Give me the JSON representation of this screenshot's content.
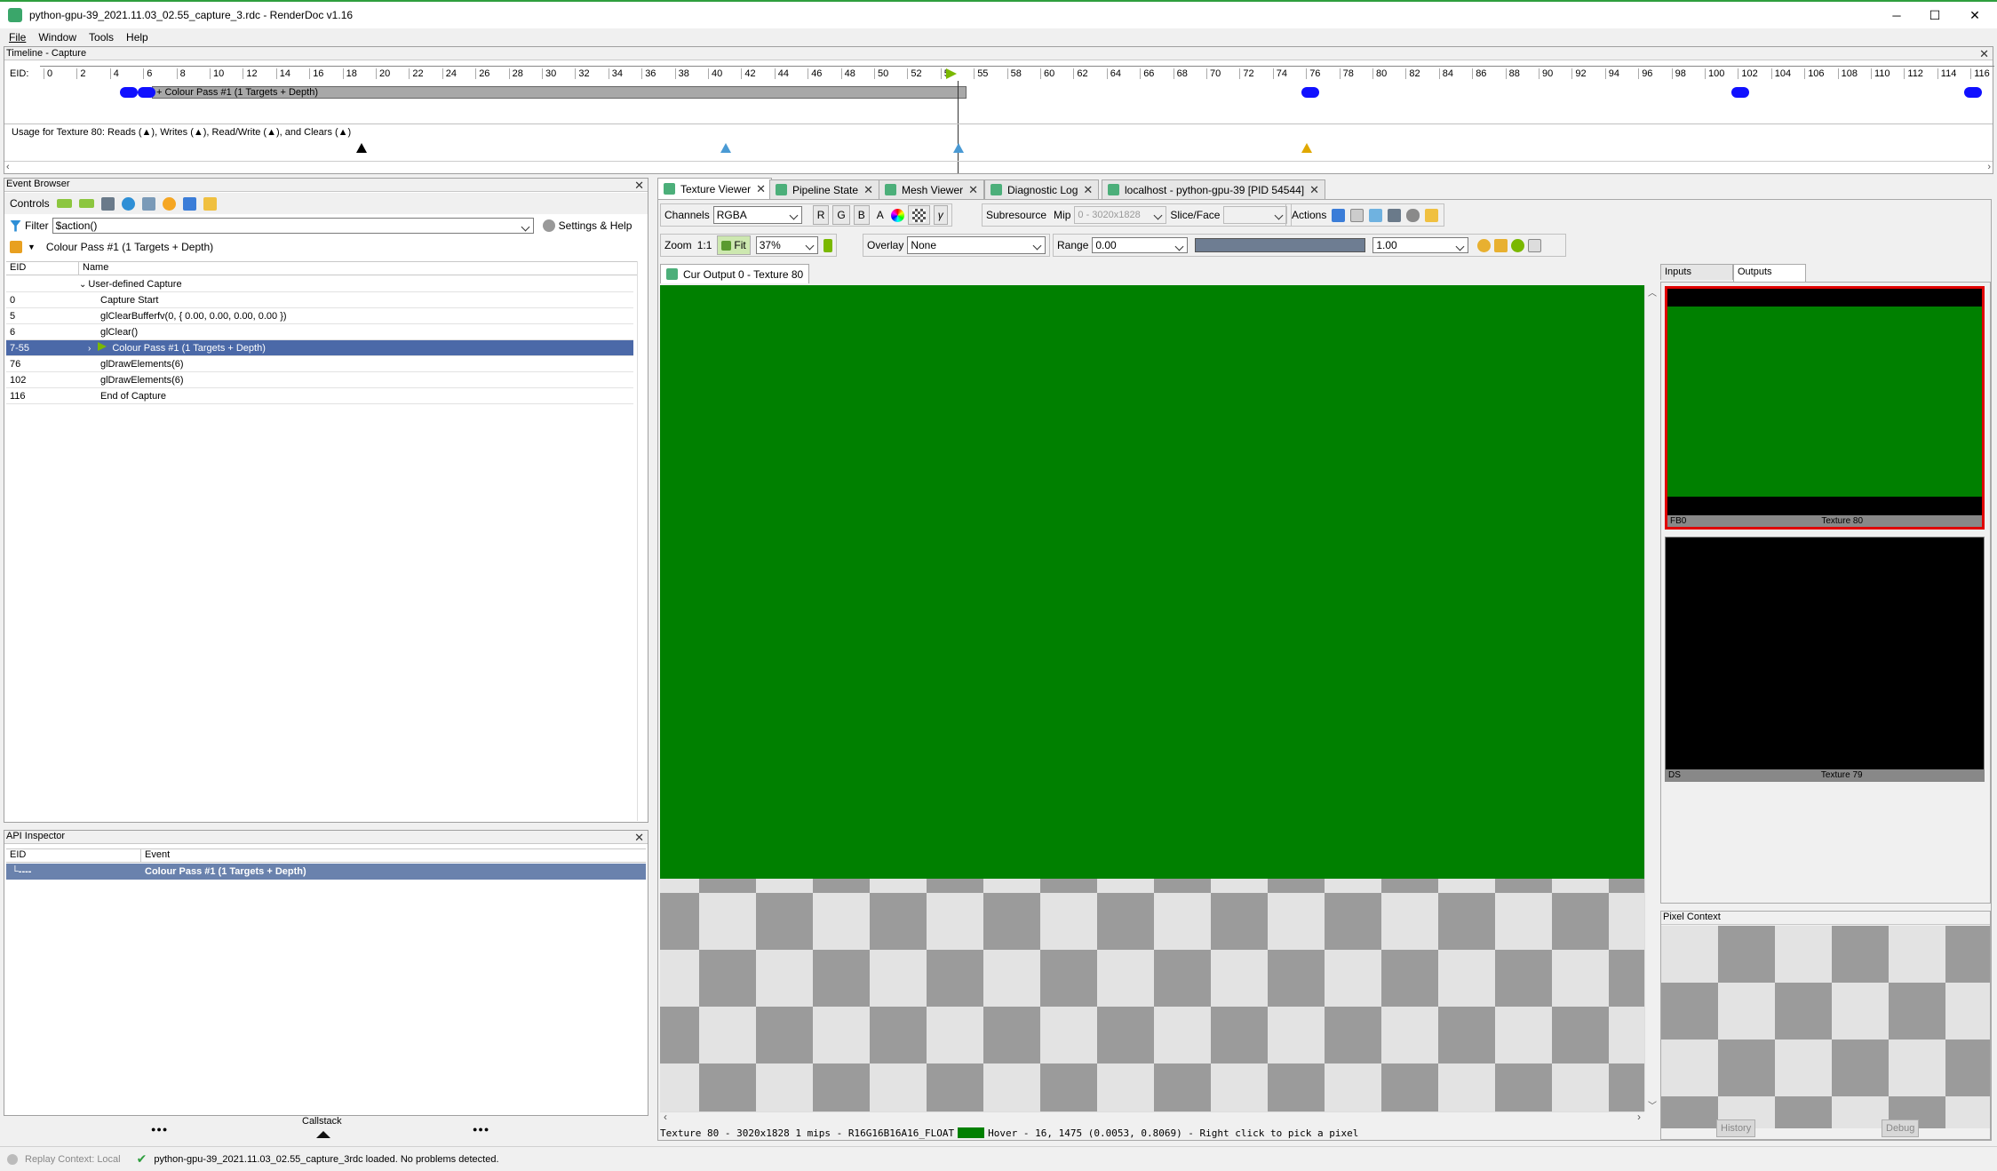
{
  "window": {
    "title": "python-gpu-39_2021.11.03_02.55_capture_3.rdc - RenderDoc v1.16",
    "minimize": "─",
    "maximize": "☐",
    "close": "✕"
  },
  "menu": [
    "File",
    "Window",
    "Tools",
    "Help"
  ],
  "timeline": {
    "title": "Timeline - Capture",
    "eid_label": "EID:",
    "ticks": [
      "0",
      "2",
      "4",
      "6",
      "8",
      "10",
      "12",
      "14",
      "16",
      "18",
      "20",
      "22",
      "24",
      "26",
      "28",
      "30",
      "32",
      "34",
      "36",
      "38",
      "40",
      "42",
      "44",
      "46",
      "48",
      "50",
      "52",
      "5",
      "55",
      "58",
      "60",
      "62",
      "64",
      "66",
      "68",
      "70",
      "72",
      "74",
      "76",
      "78",
      "80",
      "82",
      "84",
      "86",
      "88",
      "90",
      "92",
      "94",
      "96",
      "98",
      "100",
      "102",
      "104",
      "106",
      "108",
      "110",
      "112",
      "114",
      "116"
    ],
    "pass_label": "+ Colour Pass #1 (1 Targets + Depth)",
    "usage_text": "Usage for Texture 80: Reads (▲), Writes (▲), Read/Write (▲), and Clears (▲)"
  },
  "event_browser": {
    "title": "Event Browser",
    "controls_label": "Controls",
    "filter_label": "Filter",
    "filter_value": "$action()",
    "settings_label": "Settings & Help",
    "breadcrumb": "Colour Pass #1 (1 Targets + Depth)",
    "columns": {
      "eid": "EID",
      "name": "Name"
    },
    "rows": [
      {
        "eid": "",
        "name": "User-defined Capture"
      },
      {
        "eid": "0",
        "name": "Capture Start"
      },
      {
        "eid": "5",
        "name": "glClearBufferfv(0, { 0.00, 0.00, 0.00, 0.00 })"
      },
      {
        "eid": "6",
        "name": "glClear()"
      },
      {
        "eid": "7-55",
        "name": "Colour Pass #1 (1 Targets + Depth)"
      },
      {
        "eid": "76",
        "name": "glDrawElements(6)"
      },
      {
        "eid": "102",
        "name": "glDrawElements(6)"
      },
      {
        "eid": "116",
        "name": "End of Capture"
      }
    ]
  },
  "api_inspector": {
    "title": "API Inspector",
    "columns": {
      "eid": "EID",
      "event": "Event"
    },
    "row": {
      "eid": "└----",
      "event": "Colour Pass #1 (1 Targets + Depth)"
    },
    "callstack": "Callstack",
    "dots": "●●●"
  },
  "tabs": [
    {
      "label": "Texture Viewer"
    },
    {
      "label": "Pipeline State"
    },
    {
      "label": "Mesh Viewer"
    },
    {
      "label": "Diagnostic Log"
    },
    {
      "label": "localhost - python-gpu-39 [PID 54544]"
    }
  ],
  "toolbar": {
    "channels_label": "Channels",
    "channels_value": "RGBA",
    "r": "R",
    "g": "G",
    "b": "B",
    "a": "A",
    "subresource_label": "Subresource",
    "mip_label": "Mip",
    "mip_value": "0 - 3020x1828",
    "slice_label": "Slice/Face",
    "actions_label": "Actions",
    "zoom_label": "Zoom",
    "zoom_1to1": "1:1",
    "fit_label": "Fit",
    "zoom_value": "37%",
    "overlay_label": "Overlay",
    "overlay_value": "None",
    "range_label": "Range",
    "range_min": "0.00",
    "range_max": "1.00"
  },
  "texture_tab": "Cur Output 0 - Texture 80",
  "texture_color": "#008000",
  "status_line": {
    "prefix": "Texture 80 - 3020x1828 1 mips - R16G16B16A16_FLOAT",
    "hover": "Hover -    16, 1475 (0.0053, 0.8069) - Right click to pick a pixel"
  },
  "outputs_panel": {
    "inputs_tab": "Inputs",
    "outputs_tab": "Outputs",
    "thumbs": [
      {
        "left": "FB0",
        "right": "Texture 80"
      },
      {
        "left": "DS",
        "right": "Texture 79"
      }
    ]
  },
  "pixel_context": {
    "title": "Pixel Context",
    "history": "History",
    "debug": "Debug"
  },
  "statusbar": {
    "replay": "Replay Context: Local",
    "message": "python-gpu-39_2021.11.03_02.55_capture_3rdc loaded. No problems detected."
  }
}
